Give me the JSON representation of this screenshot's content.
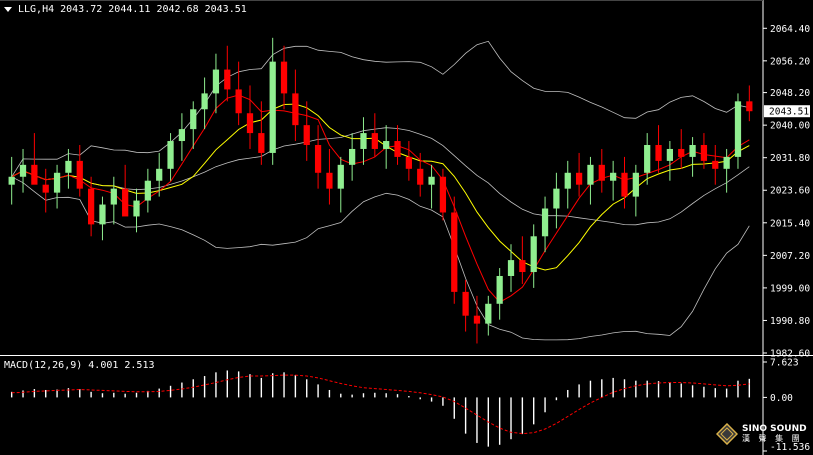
{
  "header": {
    "symbol": "LLG,H4",
    "ohlc": "2043.72 2044.11 2042.68 2043.51"
  },
  "price_axis": {
    "ticks": [
      "2064.40",
      "2056.20",
      "2048.20",
      "2040.00",
      "2031.80",
      "2023.60",
      "2015.40",
      "2007.20",
      "1999.00",
      "1990.80",
      "1982.60"
    ],
    "current_price_label": "2043.51"
  },
  "macd_axis": {
    "ticks": [
      "7.623",
      "0.00",
      "-11.536"
    ]
  },
  "macd": {
    "label": "MACD(12,26,9)",
    "main_value": "4.001",
    "signal_value": "2.513"
  },
  "logo": {
    "name": "SINO SOUND",
    "chinese": "漢 聲 集 團"
  },
  "colors": {
    "background": "#000000",
    "bull_candle": "#90EE90",
    "bear_candle": "#FF0000",
    "bollinger": "#C0C0C0",
    "ma_fast": "#FF0000",
    "ma_slow": "#FFFF00",
    "macd_hist": "#FFFFFF",
    "macd_signal": "#FF0000",
    "axis": "#FFFFFF"
  },
  "chart_data": [
    {
      "type": "candlestick",
      "title": "LLG,H4",
      "ylim": [
        1982.6,
        2068.0
      ],
      "indicators": [
        "Bollinger Bands",
        "Moving Average (red)",
        "Moving Average (yellow)"
      ],
      "ohlc": [
        [
          2025,
          2032,
          2020,
          2027
        ],
        [
          2027,
          2034,
          2023,
          2030
        ],
        [
          2030,
          2038,
          2026,
          2025
        ],
        [
          2025,
          2029,
          2018,
          2023
        ],
        [
          2023,
          2030,
          2019,
          2028
        ],
        [
          2028,
          2034,
          2024,
          2031
        ],
        [
          2031,
          2035,
          2022,
          2024
        ],
        [
          2024,
          2027,
          2012,
          2015
        ],
        [
          2015,
          2022,
          2011,
          2020
        ],
        [
          2020,
          2027,
          2015,
          2024
        ],
        [
          2024,
          2030,
          2019,
          2017
        ],
        [
          2017,
          2024,
          2013,
          2021
        ],
        [
          2021,
          2029,
          2018,
          2026
        ],
        [
          2026,
          2033,
          2022,
          2029
        ],
        [
          2029,
          2038,
          2026,
          2036
        ],
        [
          2036,
          2043,
          2031,
          2039
        ],
        [
          2039,
          2046,
          2034,
          2044
        ],
        [
          2044,
          2052,
          2039,
          2048
        ],
        [
          2048,
          2058,
          2043,
          2054
        ],
        [
          2054,
          2060,
          2046,
          2049
        ],
        [
          2049,
          2056,
          2040,
          2043
        ],
        [
          2043,
          2050,
          2034,
          2038
        ],
        [
          2038,
          2046,
          2030,
          2033
        ],
        [
          2033,
          2062,
          2030,
          2056
        ],
        [
          2056,
          2060,
          2044,
          2048
        ],
        [
          2048,
          2054,
          2036,
          2040
        ],
        [
          2040,
          2046,
          2031,
          2035
        ],
        [
          2035,
          2040,
          2024,
          2028
        ],
        [
          2028,
          2034,
          2020,
          2024
        ],
        [
          2024,
          2032,
          2018,
          2030
        ],
        [
          2030,
          2038,
          2026,
          2034
        ],
        [
          2034,
          2042,
          2030,
          2038
        ],
        [
          2038,
          2043,
          2032,
          2034
        ],
        [
          2034,
          2040,
          2029,
          2036
        ],
        [
          2036,
          2040,
          2030,
          2032
        ],
        [
          2032,
          2036,
          2026,
          2029
        ],
        [
          2029,
          2033,
          2022,
          2025
        ],
        [
          2025,
          2030,
          2019,
          2027
        ],
        [
          2027,
          2029,
          2016,
          2018
        ],
        [
          2018,
          2022,
          1995,
          1998
        ],
        [
          1998,
          2001,
          1988,
          1992
        ],
        [
          1992,
          1997,
          1985,
          1990
        ],
        [
          1990,
          1997,
          1987,
          1995
        ],
        [
          1995,
          2004,
          1991,
          2002
        ],
        [
          2002,
          2010,
          1998,
          2006
        ],
        [
          2006,
          2012,
          2000,
          2003
        ],
        [
          2003,
          2015,
          1999,
          2012
        ],
        [
          2012,
          2022,
          2008,
          2019
        ],
        [
          2019,
          2028,
          2014,
          2024
        ],
        [
          2024,
          2031,
          2019,
          2028
        ],
        [
          2028,
          2033,
          2022,
          2025
        ],
        [
          2025,
          2032,
          2020,
          2030
        ],
        [
          2030,
          2034,
          2023,
          2026
        ],
        [
          2026,
          2031,
          2021,
          2028
        ],
        [
          2028,
          2032,
          2019,
          2022
        ],
        [
          2022,
          2030,
          2017,
          2028
        ],
        [
          2028,
          2038,
          2025,
          2035
        ],
        [
          2035,
          2040,
          2028,
          2031
        ],
        [
          2031,
          2036,
          2026,
          2034
        ],
        [
          2034,
          2039,
          2029,
          2032
        ],
        [
          2032,
          2037,
          2027,
          2035
        ],
        [
          2035,
          2038,
          2029,
          2031
        ],
        [
          2031,
          2035,
          2025,
          2029
        ],
        [
          2029,
          2034,
          2023,
          2032
        ],
        [
          2032,
          2048,
          2029,
          2046
        ],
        [
          2046,
          2050,
          2041,
          2043.51
        ]
      ]
    },
    {
      "type": "macd",
      "title": "MACD(12,26,9)",
      "ylim": [
        -11.536,
        7.623
      ],
      "histogram": [
        1.2,
        1.5,
        1.8,
        1.6,
        1.7,
        2.0,
        1.8,
        1.2,
        0.9,
        1.0,
        0.8,
        1.0,
        1.4,
        1.9,
        2.5,
        3.2,
        3.9,
        4.6,
        5.4,
        5.8,
        5.6,
        5.0,
        4.2,
        5.2,
        5.4,
        4.8,
        3.9,
        2.8,
        1.6,
        0.8,
        0.6,
        0.9,
        1.0,
        0.9,
        0.7,
        0.3,
        -0.4,
        -0.9,
        -1.8,
        -4.6,
        -7.8,
        -9.8,
        -10.6,
        -10.2,
        -9.0,
        -7.9,
        -5.8,
        -3.2,
        -0.6,
        1.6,
        2.8,
        3.6,
        3.9,
        4.2,
        3.9,
        3.6,
        3.6,
        3.5,
        3.3,
        3.0,
        2.6,
        2.3,
        2.0,
        1.9,
        3.6,
        4.0
      ],
      "signal": [
        1.0,
        1.1,
        1.3,
        1.4,
        1.5,
        1.6,
        1.7,
        1.6,
        1.5,
        1.4,
        1.3,
        1.2,
        1.2,
        1.3,
        1.5,
        1.8,
        2.2,
        2.7,
        3.2,
        3.8,
        4.3,
        4.6,
        4.6,
        4.7,
        4.8,
        4.8,
        4.6,
        4.2,
        3.6,
        3.0,
        2.5,
        2.1,
        1.9,
        1.7,
        1.5,
        1.3,
        1.0,
        0.6,
        0.1,
        -0.9,
        -2.3,
        -3.8,
        -5.3,
        -6.6,
        -7.5,
        -7.8,
        -7.6,
        -6.8,
        -5.6,
        -4.1,
        -2.6,
        -1.2,
        0.0,
        1.1,
        1.9,
        2.5,
        2.9,
        3.1,
        3.2,
        3.2,
        3.1,
        2.9,
        2.7,
        2.5,
        2.6,
        2.9
      ]
    }
  ]
}
